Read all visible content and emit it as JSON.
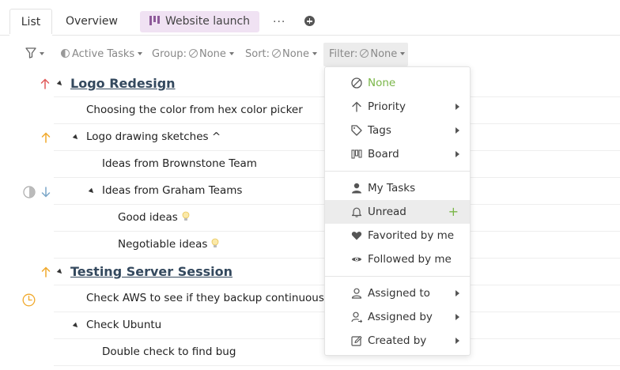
{
  "tabs": {
    "list": "List",
    "overview": "Overview",
    "board": "Website launch",
    "more": "···"
  },
  "toolbar": {
    "active_tasks": "Active Tasks",
    "group_label": "Group:",
    "group_value": "None",
    "sort_label": "Sort:",
    "sort_value": "None",
    "filter_label": "Filter:",
    "filter_value": "None"
  },
  "tasks": [
    {
      "title": "Logo Redesign",
      "level": 0,
      "heading": true
    },
    {
      "title": "Choosing the color from hex color picker",
      "level": 1
    },
    {
      "title": "Logo drawing sketches ^",
      "level": 1
    },
    {
      "title": "Ideas from Brownstone Team",
      "level": 2
    },
    {
      "title": "Ideas from Graham Teams",
      "level": 2
    },
    {
      "title": "Good ideas",
      "level": 3
    },
    {
      "title": "Negotiable ideas",
      "level": 3
    },
    {
      "title": "Testing Server Session",
      "level": 0,
      "heading": true
    },
    {
      "title": "Check AWS to see if they backup continuously",
      "level": 1
    },
    {
      "title": "Check Ubuntu",
      "level": 1
    },
    {
      "title": "Double check to find bug",
      "level": 2
    }
  ],
  "filter_menu": {
    "none": "None",
    "priority": "Priority",
    "tags": "Tags",
    "board": "Board",
    "my_tasks": "My Tasks",
    "unread": "Unread",
    "favorited": "Favorited by me",
    "followed": "Followed by me",
    "assigned_to": "Assigned to",
    "assigned_by": "Assigned by",
    "created_by": "Created by",
    "add": "+"
  },
  "colors": {
    "accent_green": "#7ab648",
    "priority_high": "#e05a5a",
    "priority_medium": "#f0a92c",
    "priority_low": "#7aa6c8",
    "board_tab_bg": "#f0e2f3",
    "heading_text": "#34495e"
  },
  "icons": {
    "board_tab": "board-icon",
    "filter": "funnel-icon",
    "none": "ban-icon",
    "priority": "arrow-up-icon",
    "tags": "tag-icon",
    "board": "board-icon",
    "my_tasks": "user-icon",
    "unread": "bell-icon",
    "favorited": "heart-icon",
    "followed": "eye-icon",
    "assigned_to": "user-outline-icon",
    "assigned_by": "user-arrow-icon",
    "created_by": "edit-icon"
  }
}
